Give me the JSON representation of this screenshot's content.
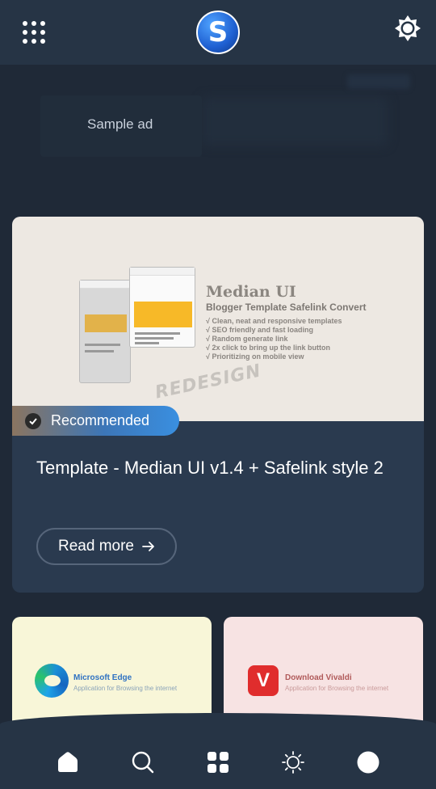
{
  "header": {
    "apps_icon": "grid-dots-icon",
    "logo_icon": "safelink-s-logo",
    "theme_icon": "brightness-icon"
  },
  "ad": {
    "label": "Sample ad"
  },
  "featured": {
    "thumb": {
      "title": "Median UI",
      "subtitle": "Blogger Template Safelink Convert",
      "features": [
        "√ Clean, neat and responsive templates",
        "√ SEO friendly and fast loading",
        "√ Random generate link",
        "√ 2x click to bring up the link button",
        "√ Prioritizing on mobile view"
      ],
      "stamp": "REDESIGN"
    },
    "badge": "Recommended",
    "title": "Template - Median UI v1.4 + Safelink style 2",
    "read_more": "Read more",
    "read_more_icon": "arrow-right-icon"
  },
  "cards": [
    {
      "title": "Microsoft Edge",
      "subtitle": "Application for Browsing the internet",
      "icon": "edge-logo"
    },
    {
      "title": "Download Vivaldi",
      "subtitle": "Application for Browsing the internet",
      "icon": "vivaldi-logo"
    }
  ],
  "bottom_nav": [
    {
      "icon": "home-icon"
    },
    {
      "icon": "search-icon"
    },
    {
      "icon": "apps-grid-icon"
    },
    {
      "icon": "sun-icon"
    },
    {
      "icon": "profile-circle-icon"
    }
  ],
  "colors": {
    "background": "#1f2937",
    "header": "#263445",
    "card": "#2a3a4f",
    "badge_accent": "#3a8fe0"
  }
}
